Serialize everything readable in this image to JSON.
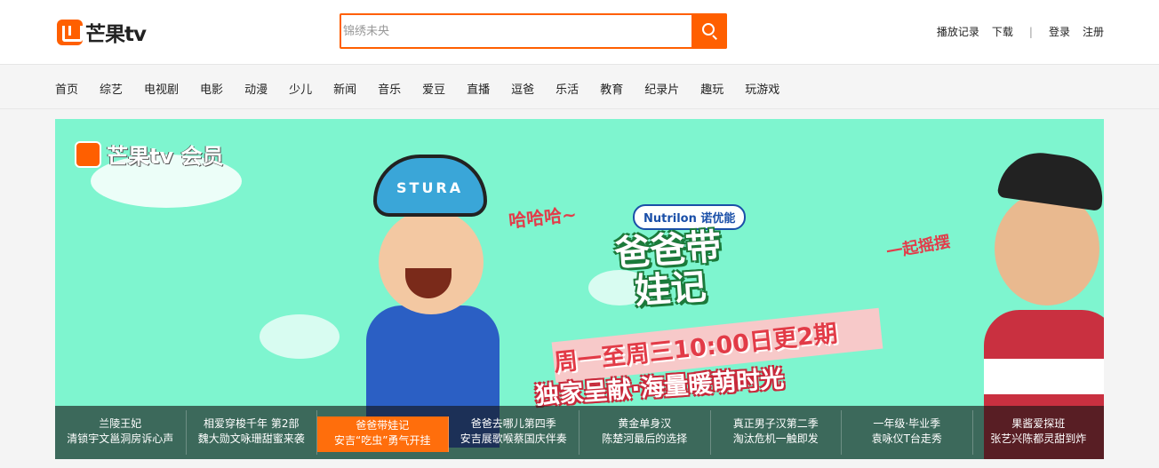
{
  "header": {
    "logo_text": "芒果tv",
    "search_placeholder": "锦绣未央",
    "links": {
      "history": "播放记录",
      "download": "下载",
      "separator": "|",
      "login": "登录",
      "register": "注册"
    }
  },
  "nav": {
    "items": [
      "首页",
      "综艺",
      "电视剧",
      "电影",
      "动漫",
      "少儿",
      "新闻",
      "音乐",
      "爱豆",
      "直播",
      "逗爸",
      "乐活",
      "教育",
      "纪录片",
      "趣玩",
      "玩游戏"
    ]
  },
  "banner": {
    "vip_logo": "芒果tv 会员",
    "cap_text": "STURA",
    "sponsor": "Nutrilon 诺优能",
    "show_title": "爸爸带娃记",
    "haha": "哈哈哈~",
    "yiqi": "一起摇摆",
    "schedule": "周一至周三10:00日更2期",
    "slogan": "独家呈献·海量暖萌时光"
  },
  "thumbs": [
    {
      "title": "兰陵王妃",
      "subtitle": "清锁宇文邕洞房诉心声"
    },
    {
      "title": "相爱穿梭千年 第2部",
      "subtitle": "魏大勋文咏珊甜蜜来袭"
    },
    {
      "title": "爸爸带娃记",
      "subtitle": "安吉“吃虫”勇气开挂"
    },
    {
      "title": "爸爸去哪儿第四季",
      "subtitle": "安吉展歌喉蔡国庆伴奏"
    },
    {
      "title": "黄金单身汉",
      "subtitle": "陈楚河最后的选择"
    },
    {
      "title": "真正男子汉第二季",
      "subtitle": "淘汰危机一触即发"
    },
    {
      "title": "一年级·毕业季",
      "subtitle": "袁咏仪T台走秀"
    },
    {
      "title": "果酱爱探班",
      "subtitle": "张艺兴陈都灵甜到炸"
    }
  ],
  "colors": {
    "brand": "#ff5f00",
    "banner_bg": "#7ef5cf",
    "active_thumb": "#ff6e0c"
  }
}
